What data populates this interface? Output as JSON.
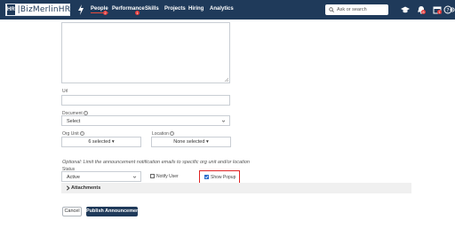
{
  "colors": {
    "nav_bg": "#1f3a5a",
    "badge": "#e23b3b",
    "highlight": "#e02424",
    "primary": "#1f3a5a"
  },
  "header": {
    "logo_mark": "HR",
    "logo_text": "|BizMerlinHR",
    "nav": [
      {
        "label": "People",
        "active": true,
        "badge": "2"
      },
      {
        "label": "Performance",
        "active": false,
        "badge": "1"
      },
      {
        "label": "Skills",
        "active": false
      },
      {
        "label": "Projects",
        "active": false
      },
      {
        "label": "Hiring",
        "active": false
      },
      {
        "label": "Analytics",
        "active": false
      }
    ],
    "search_placeholder": "Ask or search",
    "icons": [
      "graduation-cap-icon",
      "bell-icon",
      "calendar-icon",
      "help-icon",
      "settings-icon"
    ],
    "bell_badge": "8",
    "calendar_badge": "1"
  },
  "form": {
    "url_label": "Url",
    "url_value": "",
    "document_label": "Document",
    "document_value": "Select",
    "org_unit_label": "Org Unit",
    "org_unit_value": "6 selected",
    "location_label": "Location",
    "location_value": "None selected",
    "help_text": "Optional: Limit the announcement notification emails to specific org unit and/or location",
    "status_label": "Status",
    "status_value": "Active",
    "notify_label": "Notify User",
    "notify_checked": false,
    "popup_label": "Show Popup",
    "popup_checked": true,
    "attachments_label": "Attachments",
    "cancel_label": "Cancel",
    "publish_label": "Publish Announcement"
  }
}
